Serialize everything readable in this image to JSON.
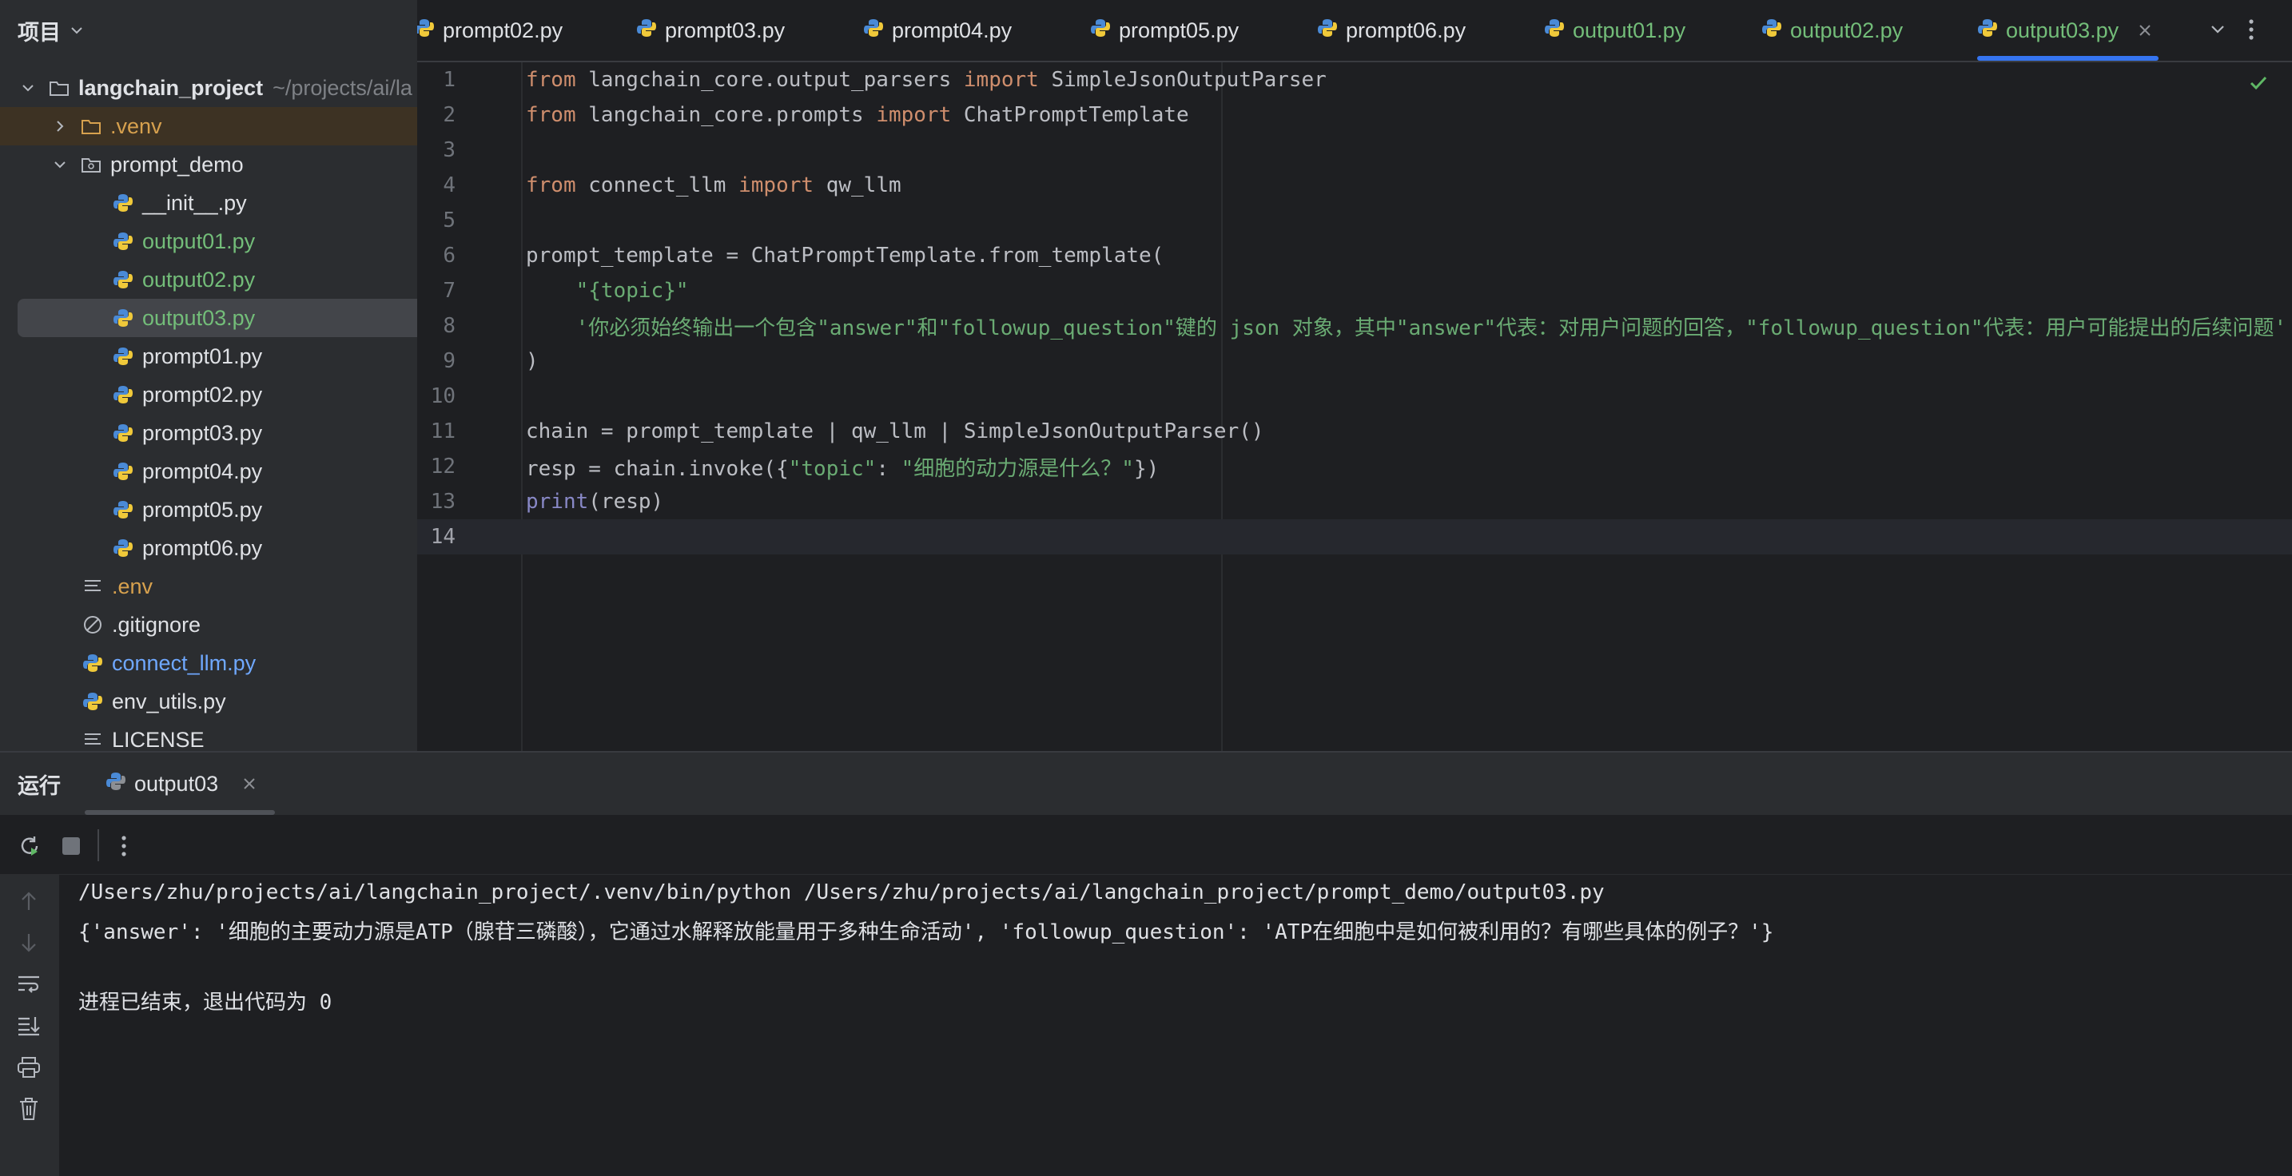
{
  "sidebar": {
    "title": "项目",
    "root": {
      "name": "langchain_project",
      "path": "~/projects/ai/la"
    },
    "items": [
      {
        "label": ".venv",
        "icon": "folder-icon"
      },
      {
        "label": "prompt_demo",
        "icon": "package-folder-icon"
      },
      {
        "label": "__init__.py",
        "icon": "python-file-icon"
      },
      {
        "label": "output01.py",
        "icon": "python-file-icon"
      },
      {
        "label": "output02.py",
        "icon": "python-file-icon"
      },
      {
        "label": "output03.py",
        "icon": "python-file-icon"
      },
      {
        "label": "prompt01.py",
        "icon": "python-file-icon"
      },
      {
        "label": "prompt02.py",
        "icon": "python-file-icon"
      },
      {
        "label": "prompt03.py",
        "icon": "python-file-icon"
      },
      {
        "label": "prompt04.py",
        "icon": "python-file-icon"
      },
      {
        "label": "prompt05.py",
        "icon": "python-file-icon"
      },
      {
        "label": "prompt06.py",
        "icon": "python-file-icon"
      },
      {
        "label": ".env",
        "icon": "text-file-icon"
      },
      {
        "label": ".gitignore",
        "icon": "ignore-file-icon"
      },
      {
        "label": "connect_llm.py",
        "icon": "python-file-icon"
      },
      {
        "label": "env_utils.py",
        "icon": "python-file-icon"
      },
      {
        "label": "LICENSE",
        "icon": "text-file-icon"
      }
    ]
  },
  "tabs": [
    {
      "label": "prompt02.py"
    },
    {
      "label": "prompt03.py"
    },
    {
      "label": "prompt04.py"
    },
    {
      "label": "prompt05.py"
    },
    {
      "label": "prompt06.py"
    },
    {
      "label": "output01.py"
    },
    {
      "label": "output02.py"
    },
    {
      "label": "output03.py",
      "active": true
    }
  ],
  "editor": {
    "current_line": 14,
    "lines": [
      {
        "n": "1",
        "t1": "from",
        "t2": " langchain_core.output_parsers ",
        "t3": "import",
        "t4": " SimpleJsonOutputParser"
      },
      {
        "n": "2",
        "t1": "from",
        "t2": " langchain_core.prompts ",
        "t3": "import",
        "t4": " ChatPromptTemplate"
      },
      {
        "n": "3"
      },
      {
        "n": "4",
        "t1": "from",
        "t2": " connect_llm ",
        "t3": "import",
        "t4": " qw_llm"
      },
      {
        "n": "5"
      },
      {
        "n": "6",
        "text": "prompt_template = ChatPromptTemplate.from_template("
      },
      {
        "n": "7",
        "indent": "    ",
        "str": "\"{topic}\""
      },
      {
        "n": "8",
        "indent": "    ",
        "str": "'你必须始终输出一个包含\"answer\"和\"followup_question\"键的 json 对象，其中\"answer\"代表：对用户问题的回答，\"followup_question\"代表：用户可能提出的后续问题'"
      },
      {
        "n": "9",
        "text": ")"
      },
      {
        "n": "10"
      },
      {
        "n": "11",
        "text": "chain = prompt_template | qw_llm | SimpleJsonOutputParser()"
      },
      {
        "n": "12",
        "pre": "resp = chain.invoke({",
        "s1": "\"topic\"",
        "mid": ": ",
        "s2": "\"细胞的动力源是什么？\"",
        "post": "})"
      },
      {
        "n": "13",
        "fn": "print",
        "post": "(resp)"
      },
      {
        "n": "14"
      }
    ]
  },
  "run": {
    "title": "运行",
    "tab_label": "output03",
    "console": [
      "/Users/zhu/projects/ai/langchain_project/.venv/bin/python /Users/zhu/projects/ai/langchain_project/prompt_demo/output03.py",
      "{'answer': '细胞的主要动力源是ATP（腺苷三磷酸），它通过水解释放能量用于多种生命活动', 'followup_question': 'ATP在细胞中是如何被利用的？有哪些具体的例子？'}",
      "",
      "进程已结束，退出代码为 0"
    ]
  },
  "colors": {
    "accent": "#3574f0",
    "keyword": "#cf8e6d",
    "string": "#6aab73",
    "modified_green": "#73bd79",
    "ignored_orange": "#d7a14e",
    "link_blue": "#6fa8ff"
  }
}
